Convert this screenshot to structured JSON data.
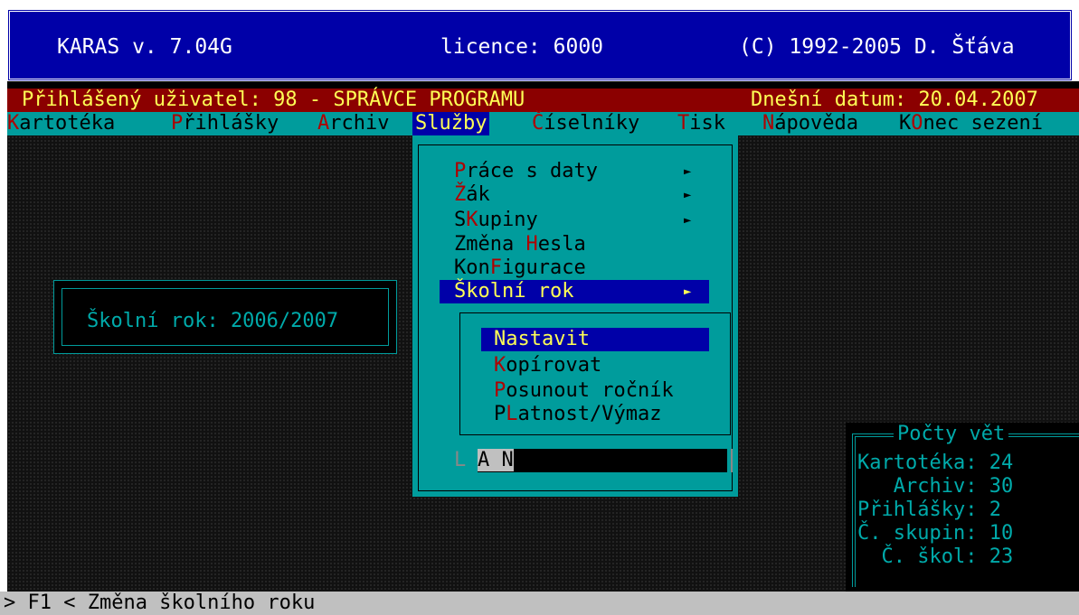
{
  "title_bar": {
    "app": "KARAS  v. 7.04G",
    "licence": "licence: 6000",
    "copyright": "(C) 1992-2005 D. Šťáva"
  },
  "user_bar": {
    "user": "Přihlášený uživatel: 98 - SPRÁVCE PROGRAMU",
    "date": "Dnešní datum: 20.04.2007"
  },
  "menu": [
    {
      "hot": "K",
      "rest": "artotéka"
    },
    {
      "hot": "P",
      "rest": "řihlášky"
    },
    {
      "hot": "A",
      "rest": "rchiv"
    },
    {
      "hot": "",
      "rest": "Služby"
    },
    {
      "hot": "Č",
      "rest": "íselníky"
    },
    {
      "hot": "T",
      "rest": "isk"
    },
    {
      "hot": "N",
      "rest": "ápověda"
    },
    {
      "pre": "K",
      "hot": "O",
      "rest": "nec sezení"
    }
  ],
  "school_year": "Školní rok: 2006/2007",
  "dropdown": [
    {
      "pre": "",
      "hot": "P",
      "rest": "ráce s daty",
      "arrow": "►"
    },
    {
      "pre": "",
      "hot": "Ž",
      "rest": "ák",
      "arrow": "►"
    },
    {
      "pre": "S",
      "hot": "K",
      "rest": "upiny",
      "arrow": "►"
    },
    {
      "pre": "Změna ",
      "hot": "H",
      "rest": "esla",
      "arrow": ""
    },
    {
      "pre": "Kon",
      "hot": "F",
      "rest": "igurace",
      "arrow": ""
    },
    {
      "pre": "",
      "hot": "",
      "rest": "Školní rok",
      "arrow": "►"
    }
  ],
  "submenu": [
    {
      "pre": "",
      "hot": "",
      "rest": "Nastavit"
    },
    {
      "pre": "",
      "hot": "K",
      "rest": "opírovat"
    },
    {
      "pre": "",
      "hot": "P",
      "rest": "osunout ročník"
    },
    {
      "pre": "P",
      "hot": "L",
      "rest": "atnost/Výmaz"
    }
  ],
  "lan": {
    "letter": "L",
    "value": "A N"
  },
  "counts": {
    "title": "Počty vět",
    "rows": [
      "Kartotéka: 24",
      "   Archiv: 30",
      "Přihlášky: 2",
      "Č. skupin: 10",
      "  Č. škol: 23"
    ]
  },
  "status": "> F1 < Změna školního roku",
  "colors": {
    "blue": "#0000a8",
    "cyan": "#009c9c",
    "red": "#8b0000",
    "yellow": "#ffff55"
  }
}
